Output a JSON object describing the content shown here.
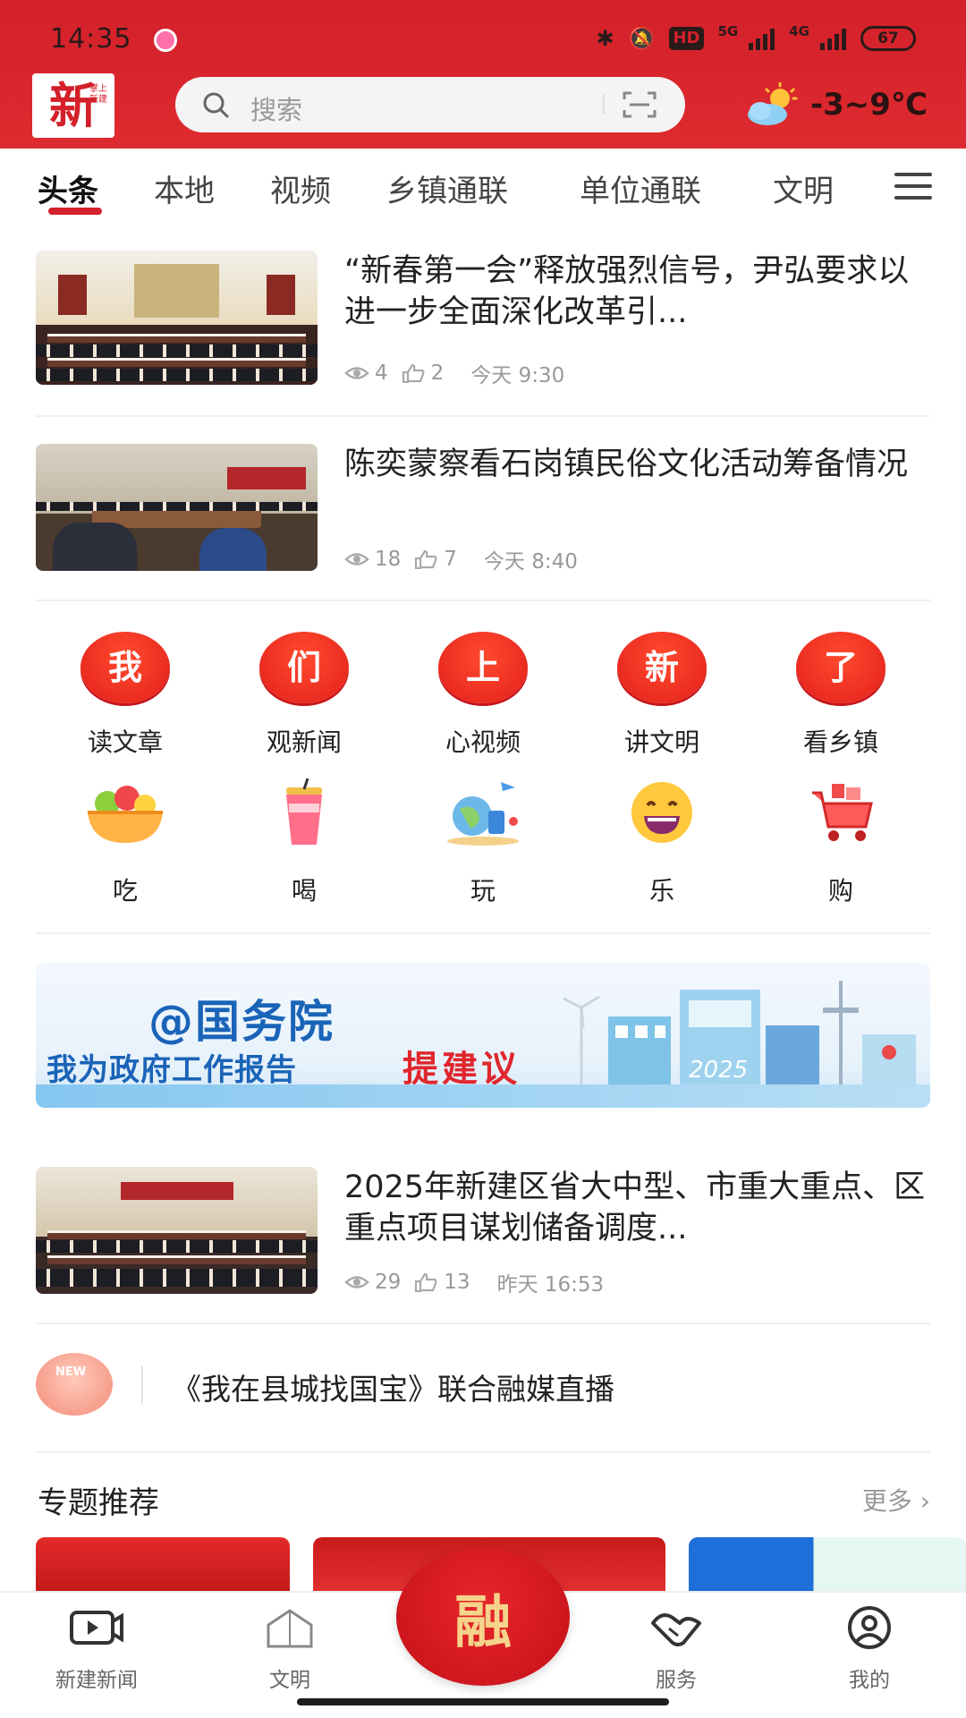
{
  "status_bar": {
    "time": "14:35",
    "hd_label": "HD",
    "net1": "5G",
    "net2": "4G",
    "battery": "67"
  },
  "header": {
    "logo_char": "新",
    "logo_sub": "掌上新建",
    "search_placeholder": "搜索",
    "weather": "-3~9℃"
  },
  "tabs": [
    "头条",
    "本地",
    "视频",
    "乡镇通联",
    "单位通联",
    "文明"
  ],
  "news": [
    {
      "title": "“新春第一会”释放强烈信号，尹弘要求以进一步全面深化改革引...",
      "views": "4",
      "likes": "2",
      "time": "今天 9:30"
    },
    {
      "title": "陈奕蒙察看石岗镇民俗文化活动筹备情况",
      "views": "18",
      "likes": "7",
      "time": "今天 8:40"
    },
    {
      "title": "2025年新建区省大中型、市重大重点、区重点项目谋划储备调度...",
      "views": "29",
      "likes": "13",
      "time": "昨天 16:53"
    }
  ],
  "shortcuts_row1": [
    {
      "badge": "我",
      "label": "读文章"
    },
    {
      "badge": "们",
      "label": "观新闻"
    },
    {
      "badge": "上",
      "label": "心视频"
    },
    {
      "badge": "新",
      "label": "讲文明"
    },
    {
      "badge": "了",
      "label": "看乡镇"
    }
  ],
  "shortcuts_row2": [
    {
      "icon": "fruit-bowl-icon",
      "label": "吃"
    },
    {
      "icon": "drink-cup-icon",
      "label": "喝"
    },
    {
      "icon": "travel-icon",
      "label": "玩"
    },
    {
      "icon": "smile-emoji-icon",
      "label": "乐"
    },
    {
      "icon": "shopping-cart-icon",
      "label": "购"
    }
  ],
  "banner": {
    "line1": "@国务院",
    "line2": "我为政府工作报告",
    "line3": "提建议",
    "year": "2025"
  },
  "live": {
    "badge": "NEW",
    "text": "《我在县城找国宝》联合融媒直播"
  },
  "section": {
    "title": "专题推荐",
    "more": "更多 ›"
  },
  "bottom_nav": {
    "items": [
      "新建新闻",
      "文明",
      "服务",
      "我的"
    ],
    "center": "融"
  },
  "colors": {
    "brand_red": "#d3202a",
    "text_primary": "#222222",
    "text_secondary": "#999999"
  }
}
